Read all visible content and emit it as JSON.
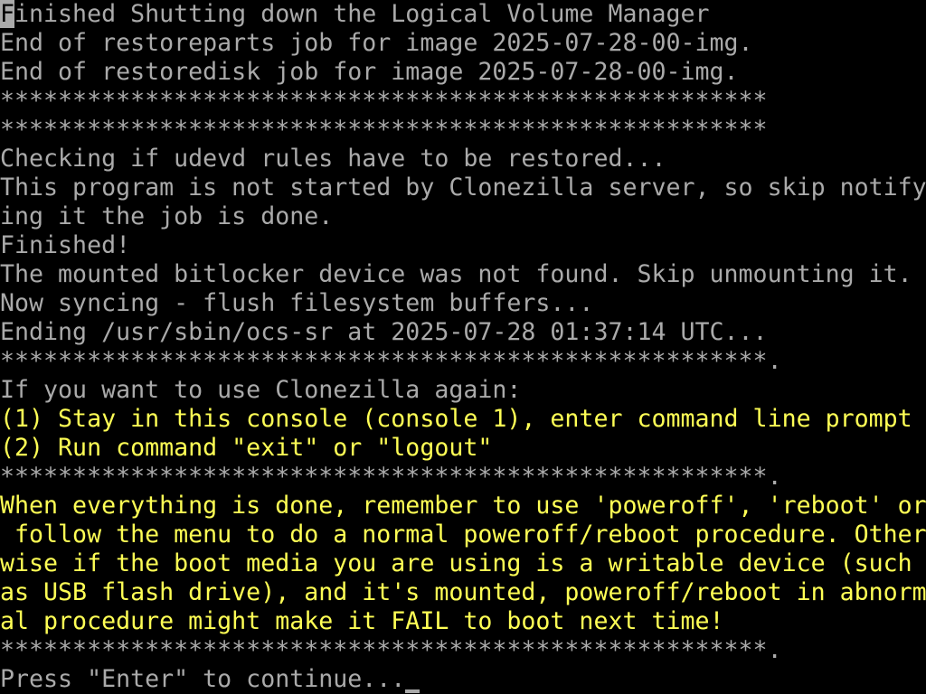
{
  "colors": {
    "background": "#000000",
    "normal_text": "#aaaaaa",
    "highlight_text": "#ffff55"
  },
  "console": {
    "first_line_first_char": "F",
    "first_line_rest": "inished Shutting down the Logical Volume Manager",
    "lines": [
      "End of restoreparts job for image 2025-07-28-00-img.",
      "End of restoredisk job for image 2025-07-28-00-img.",
      "*****************************************************",
      "*****************************************************",
      "Checking if udevd rules have to be restored...",
      "This program is not started by Clonezilla server, so skip notify",
      "ing it the job is done.",
      "Finished!",
      "The mounted bitlocker device was not found. Skip unmounting it.",
      "Now syncing - flush filesystem buffers...",
      "Ending /usr/sbin/ocs-sr at 2025-07-28 01:37:14 UTC...",
      "*****************************************************.",
      "If you want to use Clonezilla again:"
    ],
    "yellow_options": [
      "(1) Stay in this console (console 1), enter command line prompt",
      "(2) Run command \"exit\" or \"logout\""
    ],
    "separator_after_options": "*****************************************************.",
    "warning_lines": [
      "When everything is done, remember to use 'poweroff', 'reboot' or",
      " follow the menu to do a normal poweroff/reboot procedure. Other",
      "wise if the boot media you are using is a writable device (such",
      "as USB flash drive), and it's mounted, poweroff/reboot in abnorm",
      "al procedure might make it FAIL to boot next time!"
    ],
    "separator_after_warning": "*****************************************************.",
    "prompt": "Press \"Enter\" to continue..."
  }
}
